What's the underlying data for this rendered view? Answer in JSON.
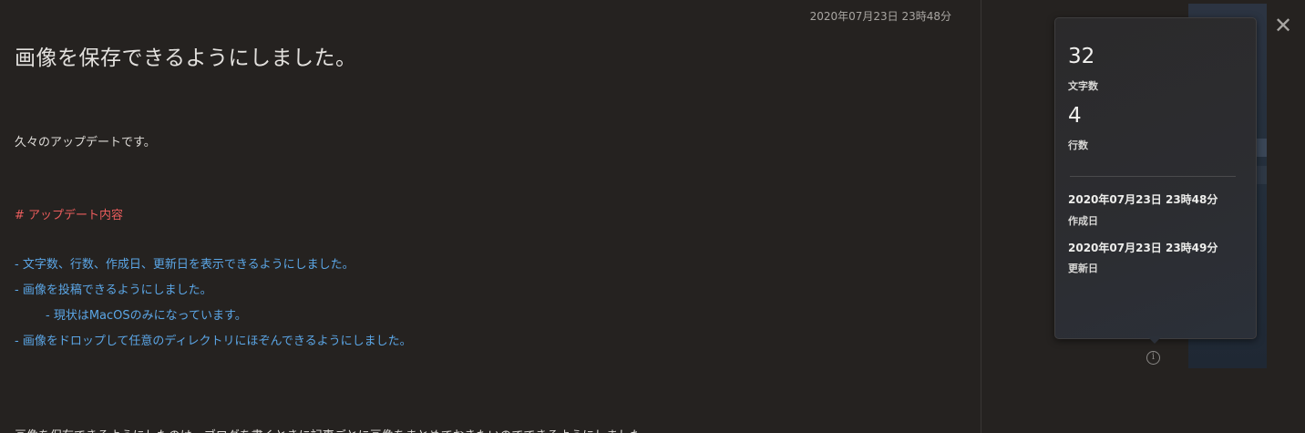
{
  "editor": {
    "timestamp": "2020年07月23日 23時48分",
    "title": "画像を保存できるようにしました。",
    "lines": [
      {
        "text": "久々のアップデートです。"
      },
      {
        "text": "# アップデート内容"
      },
      {
        "text": "- 文字数、行数、作成日、更新日を表示できるようにしました。"
      },
      {
        "text": "- 画像を投稿できるようにしました。"
      },
      {
        "text": "- 現状はMacOSのみになっています。"
      },
      {
        "text": "- 画像をドロップして任意のディレクトリにほぞんできるようにしました。"
      },
      {
        "text": "画像を保存できるようにしたのは、ブログを書くときに記事ごとに画像をまとめておきたいのでできるようにしました。"
      }
    ]
  },
  "info_popover": {
    "char_count": "32",
    "char_count_label": "文字数",
    "line_count": "4",
    "line_count_label": "行数",
    "created_date": "2020年07月23日 23時48分",
    "created_label": "作成日",
    "updated_date": "2020年07月23日 23時49分",
    "updated_label": "更新日"
  },
  "close_icon": "✕",
  "info_icon": "i",
  "colors": {
    "background": "#252220",
    "heading": "#ec5d5d",
    "list": "#5ba6e6",
    "text": "#dedcd8"
  }
}
